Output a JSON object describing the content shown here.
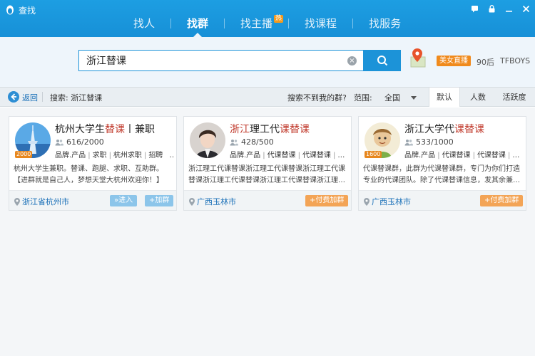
{
  "window": {
    "title": "查找"
  },
  "tabs": [
    {
      "label": "找人"
    },
    {
      "label": "找群"
    },
    {
      "label": "找主播",
      "badge": "热"
    },
    {
      "label": "找课程"
    },
    {
      "label": "找服务"
    }
  ],
  "search": {
    "value": "浙江替课",
    "clear_symbol": "×"
  },
  "promo": {
    "live_badge": "美女直播",
    "hot_words": [
      "90后",
      "TFBOYS"
    ]
  },
  "filter": {
    "back": "返回",
    "crumb": "搜索: 浙江替课",
    "not_found": "搜索不到我的群?",
    "range_label": "范围:",
    "range_value": "全国",
    "sort": [
      "默认",
      "人数",
      "活跃度"
    ]
  },
  "cards": [
    {
      "title_pre": "杭州大学生",
      "title_hl": "替课",
      "title_post": "丨兼职",
      "members": "616/2000",
      "level": "2000",
      "tags": [
        "品牌.产品",
        "求职",
        "杭州求职",
        "招聘",
        "…"
      ],
      "desc_line1": "杭州大学生兼职。替课、跑腿、求职、互助群。",
      "desc_line2": "【进群就是自己人，梦想天堂大杭州欢迎你！】",
      "location": "浙江省杭州市",
      "enter": "»进入",
      "join": "+加群"
    },
    {
      "title_hl_pre": "浙江",
      "title_mid": "理工代",
      "title_hl": "课替课",
      "members": "428/500",
      "tags": [
        "品牌.产品",
        "代课替课",
        "代课替课",
        "…"
      ],
      "desc_line1": "浙江理工代课替课浙江理工代课替课浙江理工代课",
      "desc_line2": "替课浙江理工代课替课浙江理工代课替课浙江理…",
      "location": "广西玉林市",
      "pay_join": "+付费加群"
    },
    {
      "title_pre": "浙江大学代",
      "title_hl": "课替课",
      "members": "533/1000",
      "level": "1600",
      "tags": [
        "品牌.产品",
        "代课替课",
        "代课替课",
        "…"
      ],
      "desc_line1": "代课替课群，此群为代课替课群，专门为你们打造",
      "desc_line2": "专业的代课团队。除了代课替课信息，发其余兼…",
      "location": "广西玉林市",
      "pay_join": "+付费加群"
    }
  ],
  "colors": {
    "accent": "#1c93d8",
    "highlight": "#c0392b",
    "orange": "#f3a456"
  }
}
